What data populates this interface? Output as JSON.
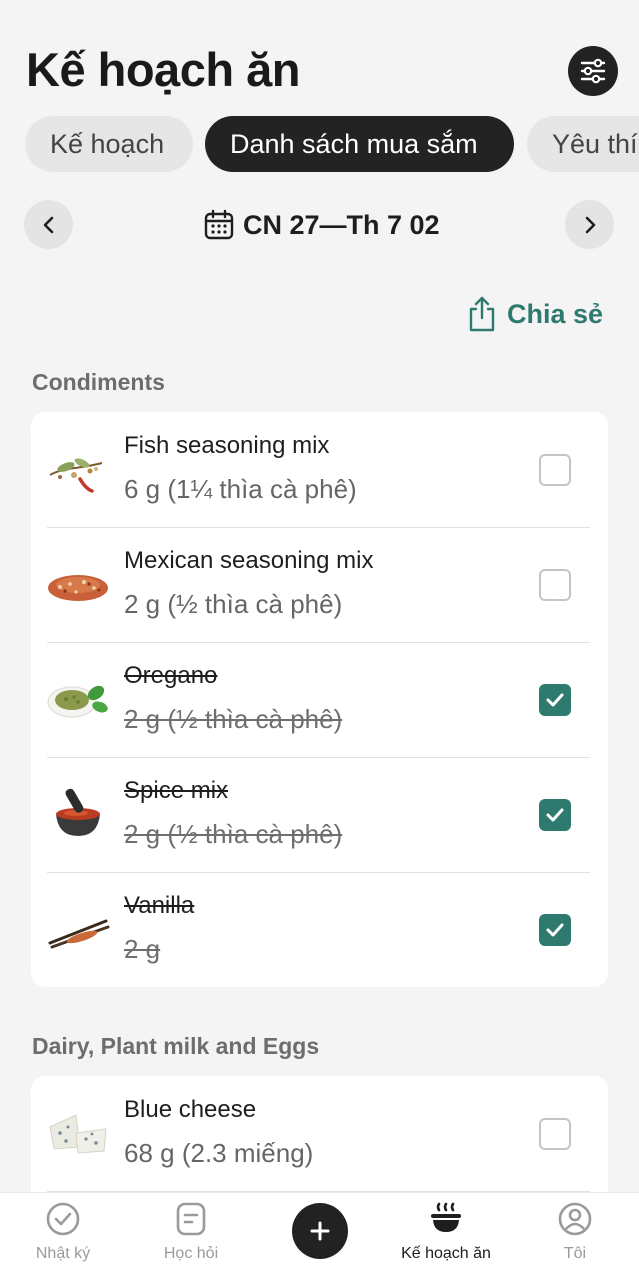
{
  "header": {
    "title": "Kế hoạch ăn",
    "filter_icon": "sliders-icon"
  },
  "tabs": [
    {
      "label": "Kế hoạch",
      "active": false
    },
    {
      "label": "Danh sách mua sắm",
      "active": true
    },
    {
      "label": "Yêu thí",
      "active": false
    }
  ],
  "date_nav": {
    "range": "CN 27—Th 7 02",
    "prev_icon": "chevron-left-icon",
    "next_icon": "chevron-right-icon",
    "calendar_icon": "calendar-icon"
  },
  "share": {
    "label": "Chia sẻ",
    "icon": "share-icon"
  },
  "accent_color": "#2f7a6e",
  "sections": [
    {
      "title": "Condiments",
      "items": [
        {
          "name": "Fish seasoning mix",
          "qty": "6 g (1¼ thìa cà phê)",
          "checked": false
        },
        {
          "name": "Mexican seasoning mix",
          "qty": "2 g (½ thìa cà phê)",
          "checked": false
        },
        {
          "name": "Oregano",
          "qty": "2 g (½ thìa cà phê)",
          "checked": true
        },
        {
          "name": "Spice mix",
          "qty": "2 g (½ thìa cà phê)",
          "checked": true
        },
        {
          "name": "Vanilla",
          "qty": "2 g",
          "checked": true
        }
      ]
    },
    {
      "title": "Dairy, Plant milk and Eggs",
      "items": [
        {
          "name": "Blue cheese",
          "qty": "68 g (2.3 miếng)",
          "checked": false
        }
      ]
    }
  ],
  "bottom_nav": [
    {
      "label": "Nhật ký",
      "icon": "check-circle-icon",
      "active": false
    },
    {
      "label": "Học hỏi",
      "icon": "note-icon",
      "active": false
    },
    {
      "label": "",
      "icon": "plus-icon",
      "active": false
    },
    {
      "label": "Kế hoạch ăn",
      "icon": "bowl-icon",
      "active": true
    },
    {
      "label": "Tôi",
      "icon": "user-icon",
      "active": false
    }
  ]
}
